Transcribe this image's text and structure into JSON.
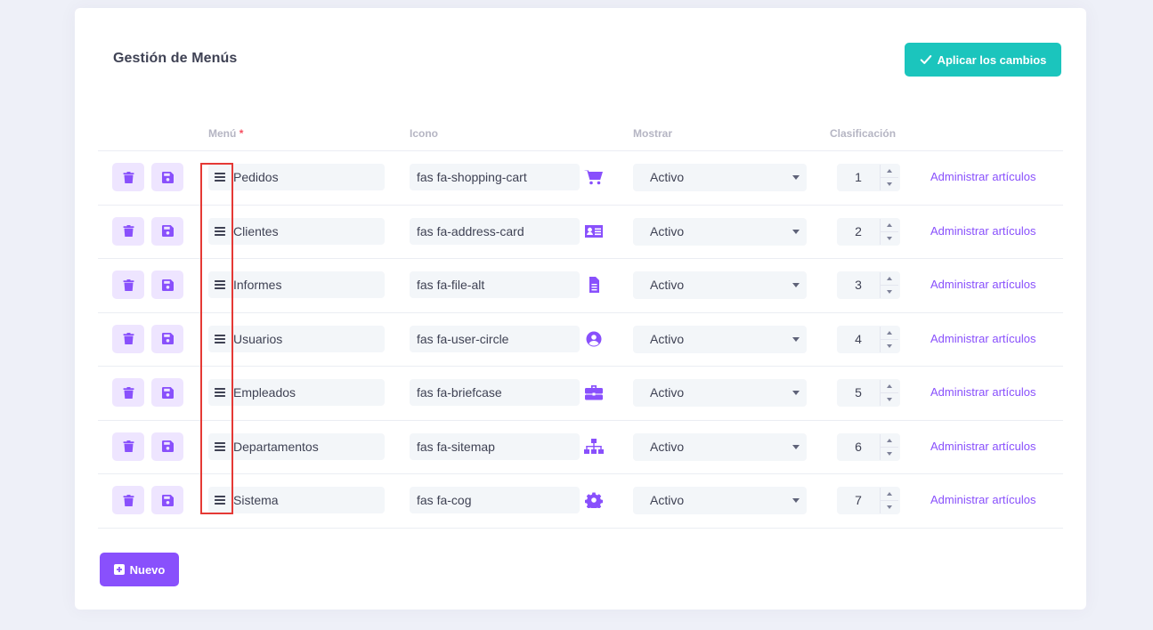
{
  "card": {
    "title": "Gestión de Menús",
    "apply_label": "Aplicar los cambios",
    "new_label": "Nuevo"
  },
  "table": {
    "headers": {
      "menu": "Menú",
      "required_mark": "*",
      "icon": "Icono",
      "show": "Mostrar",
      "rank": "Clasificación"
    },
    "rows": [
      {
        "name": "Pedidos",
        "icon_class": "fas fa-shopping-cart",
        "icon_name": "shopping-cart-icon",
        "status": "Activo",
        "rank": "1",
        "link": "Administrar artículos"
      },
      {
        "name": "Clientes",
        "icon_class": "fas fa-address-card",
        "icon_name": "address-card-icon",
        "status": "Activo",
        "rank": "2",
        "link": "Administrar artículos"
      },
      {
        "name": "Informes",
        "icon_class": "fas fa-file-alt",
        "icon_name": "file-alt-icon",
        "status": "Activo",
        "rank": "3",
        "link": "Administrar artículos"
      },
      {
        "name": "Usuarios",
        "icon_class": "fas fa-user-circle",
        "icon_name": "user-circle-icon",
        "status": "Activo",
        "rank": "4",
        "link": "Administrar artículos"
      },
      {
        "name": "Empleados",
        "icon_class": "fas fa-briefcase",
        "icon_name": "briefcase-icon",
        "status": "Activo",
        "rank": "5",
        "link": "Administrar artículos"
      },
      {
        "name": "Departamentos",
        "icon_class": "fas fa-sitemap",
        "icon_name": "sitemap-icon",
        "status": "Activo",
        "rank": "6",
        "link": "Administrar artículos"
      },
      {
        "name": "Sistema",
        "icon_class": "fas fa-cog",
        "icon_name": "cog-icon",
        "status": "Activo",
        "rank": "7",
        "link": "Administrar artículos"
      }
    ]
  },
  "colors": {
    "accent": "#8950fc",
    "accent_light": "#eee5ff",
    "success": "#1bc5bd",
    "highlight": "#e53935"
  }
}
